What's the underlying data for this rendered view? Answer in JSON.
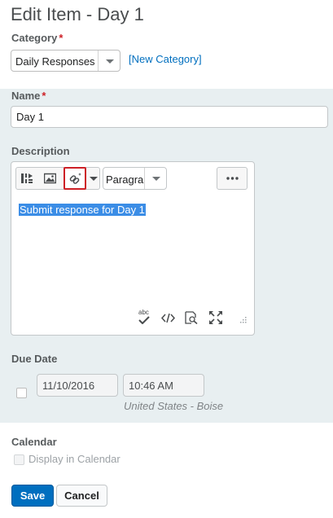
{
  "page": {
    "title": "Edit Item - Day 1"
  },
  "category": {
    "label": "Category",
    "required_mark": "*",
    "selected": "Daily Responses",
    "new_link": "[New Category]"
  },
  "name": {
    "label": "Name",
    "required_mark": "*",
    "value": "Day 1"
  },
  "description": {
    "label": "Description",
    "toolbar": {
      "icons": [
        "insert-stuff-icon",
        "image-icon",
        "quicklink-icon",
        "dropdown-arrow-icon",
        "more-icon"
      ],
      "format_selected": "Paragra"
    },
    "content": "Submit response for Day 1",
    "status_icons": [
      "spellcheck-icon",
      "source-code-icon",
      "preview-icon",
      "fullscreen-icon",
      "resize-handle-icon"
    ],
    "spellcheck_label": "abc"
  },
  "due_date": {
    "label": "Due Date",
    "date": "11/10/2016",
    "time": "10:46 AM",
    "timezone": "United States - Boise",
    "checked": false
  },
  "calendar": {
    "label": "Calendar",
    "checkbox_label": "Display in Calendar",
    "checked": false
  },
  "actions": {
    "save": "Save",
    "cancel": "Cancel"
  },
  "colors": {
    "primary": "#006fbf",
    "required": "#cd2026",
    "highlight": "#3b8de6",
    "panel_bg": "#e8eff1",
    "focus_outline": "#cd2026"
  }
}
